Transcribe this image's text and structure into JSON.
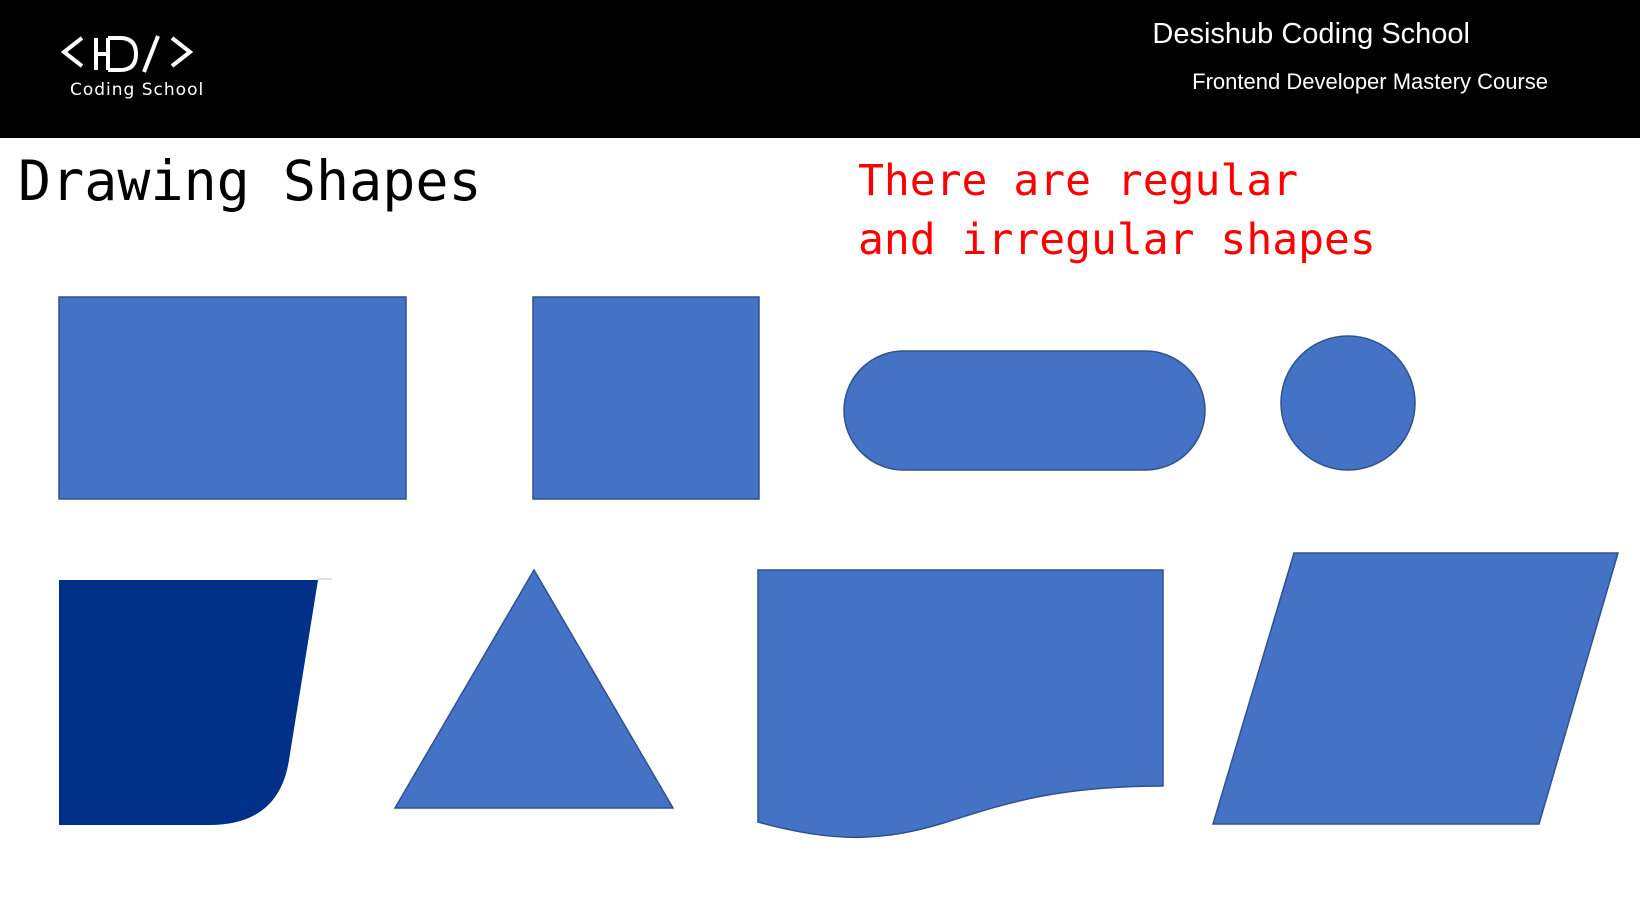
{
  "header": {
    "logo_mark": "<D/>",
    "logo_subtitle": "Coding School",
    "school_name": "Desishub Coding School",
    "course_name": "Frontend Developer Mastery Course"
  },
  "slide": {
    "title": "Drawing Shapes",
    "note_lines": [
      "There are regular",
      "and irregular shapes"
    ]
  },
  "colors": {
    "header_background": "#000000",
    "shape_fill": "#4472C4",
    "shape_stroke": "#2F528F",
    "dark_shape_fill": "#003087",
    "note_color": "#FF0000"
  },
  "shapes": [
    {
      "kind": "rectangle",
      "icon": "rectangle-shape"
    },
    {
      "kind": "square",
      "icon": "square-shape"
    },
    {
      "kind": "rounded-rectangle",
      "icon": "pill-shape"
    },
    {
      "kind": "circle",
      "icon": "circle-shape"
    },
    {
      "kind": "irregular-rounded-corner",
      "icon": "irregular-shape"
    },
    {
      "kind": "triangle",
      "icon": "triangle-shape"
    },
    {
      "kind": "document-wave",
      "icon": "document-shape"
    },
    {
      "kind": "parallelogram",
      "icon": "parallelogram-shape"
    }
  ]
}
